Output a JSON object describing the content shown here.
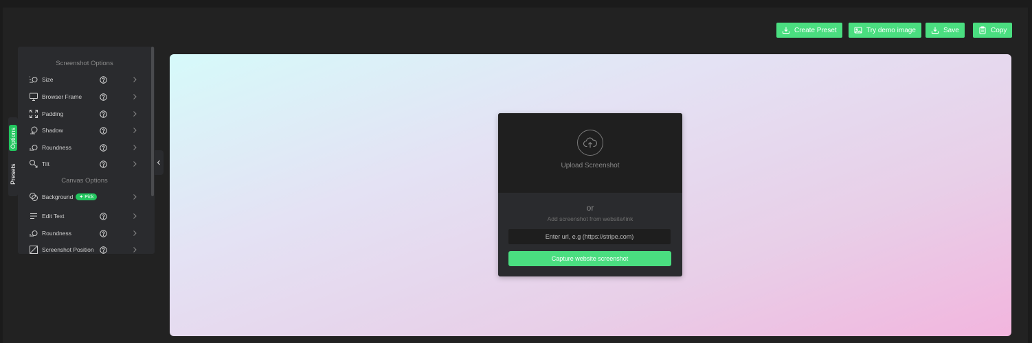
{
  "toolbar": {
    "create_preset": "Create Preset",
    "try_demo": "Try demo image",
    "save": "Save",
    "copy": "Copy"
  },
  "side_tabs": {
    "options": "Options",
    "presets": "Presets"
  },
  "screenshot_options": {
    "title": "Screenshot Options",
    "items": [
      {
        "label": "Size",
        "icon": "size-icon"
      },
      {
        "label": "Browser Frame",
        "icon": "monitor-icon"
      },
      {
        "label": "Padding",
        "icon": "expand-icon"
      },
      {
        "label": "Shadow",
        "icon": "shadow-icon"
      },
      {
        "label": "Roundness",
        "icon": "roundness-icon"
      },
      {
        "label": "Tilt",
        "icon": "tilt-icon"
      }
    ]
  },
  "canvas_options": {
    "title": "Canvas Options",
    "items": [
      {
        "label": "Background",
        "icon": "background-icon",
        "badge": "Pick"
      },
      {
        "label": "Edit Text",
        "icon": "text-lines-icon"
      },
      {
        "label": "Roundness",
        "icon": "roundness-icon"
      },
      {
        "label": "Screenshot Position",
        "icon": "position-icon"
      }
    ]
  },
  "upload": {
    "label": "Upload Screenshot",
    "or": "or",
    "sub": "Add screenshot from website/link",
    "url_placeholder": "Enter url, e.g (https://stripe.com)",
    "capture": "Capture website screenshot"
  },
  "colors": {
    "accent": "#4ade80",
    "background": "#222222",
    "panel": "#2a2b2e"
  }
}
